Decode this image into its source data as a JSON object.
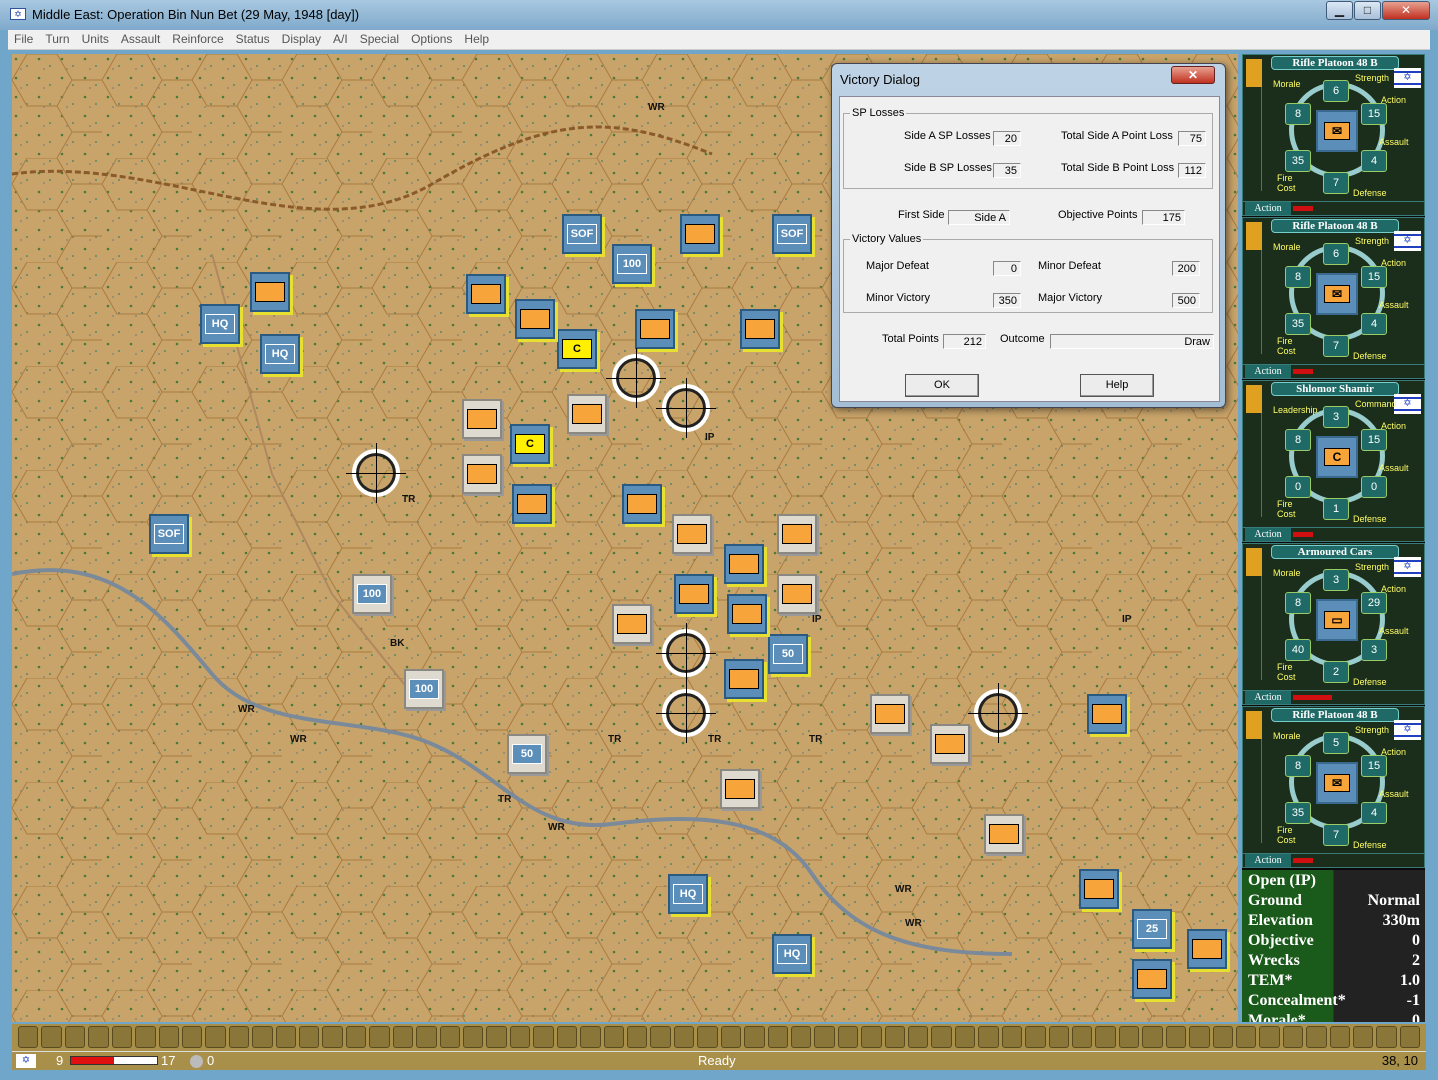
{
  "window": {
    "title": "Middle East: Operation Bin Nun Bet (29 May, 1948 [day])",
    "minimize": "▁",
    "maximize": "□",
    "close": "✕"
  },
  "menu": [
    "File",
    "Turn",
    "Units",
    "Assault",
    "Reinforce",
    "Status",
    "Display",
    "A/I",
    "Special",
    "Options",
    "Help"
  ],
  "map": {
    "counters": [
      "SOF",
      "SOF",
      "SOF",
      "HQ",
      "HQ",
      "HQ",
      "HQ",
      "C",
      "C",
      "100",
      "100",
      "100",
      "50",
      "50",
      "25"
    ],
    "labels": [
      "WR",
      "WR",
      "WR",
      "WR",
      "WR",
      "WR",
      "TR",
      "TR",
      "TR",
      "TR",
      "TR",
      "IP",
      "IP",
      "IP",
      "BK"
    ]
  },
  "dialog": {
    "title": "Victory Dialog",
    "close": "✕",
    "sp_losses": {
      "legend": "SP Losses",
      "side_a_label": "Side A SP Losses",
      "side_a": "20",
      "side_b_label": "Side B SP Losses",
      "side_b": "35",
      "total_a_label": "Total Side A Point Loss",
      "total_a": "75",
      "total_b_label": "Total Side B Point Loss",
      "total_b": "112"
    },
    "first_side_label": "First Side",
    "first_side": "Side A",
    "objective_label": "Objective Points",
    "objective": "175",
    "victory_values": {
      "legend": "Victory Values",
      "major_defeat_label": "Major Defeat",
      "major_defeat": "0",
      "minor_defeat_label": "Minor Defeat",
      "minor_defeat": "200",
      "minor_victory_label": "Minor Victory",
      "minor_victory": "350",
      "major_victory_label": "Major Victory",
      "major_victory": "500"
    },
    "total_label": "Total Points",
    "total": "212",
    "outcome_label": "Outcome",
    "outcome": "Draw",
    "ok": "OK",
    "help": "Help"
  },
  "units": [
    {
      "name": "Rifle Platoon 48 B",
      "tl": "Morale",
      "tr": "Strength",
      "r1": "Action",
      "r2": "Assault",
      "bl": "Fire Cost",
      "br": "Defense",
      "top": "6",
      "left": "8",
      "right": "15",
      "bleft": "35",
      "bright": "4",
      "bottom": "7",
      "action": "Action",
      "action_level": 0.15,
      "sym": "✉"
    },
    {
      "name": "Rifle Platoon 48 B",
      "tl": "Morale",
      "tr": "Strength",
      "r1": "Action",
      "r2": "Assault",
      "bl": "Fire Cost",
      "br": "Defense",
      "top": "6",
      "left": "8",
      "right": "15",
      "bleft": "35",
      "bright": "4",
      "bottom": "7",
      "action": "Action",
      "action_level": 0.15,
      "sym": "✉"
    },
    {
      "name": "Shlomor Shamir",
      "tl": "Leadership",
      "tr": "Command",
      "r1": "Action",
      "r2": "Assault",
      "bl": "Fire Cost",
      "br": "Defense",
      "top": "3",
      "left": "8",
      "right": "15",
      "bleft": "0",
      "bright": "0",
      "bottom": "1",
      "action": "Action",
      "action_level": 0.15,
      "sym": "C"
    },
    {
      "name": "Armoured Cars",
      "tl": "Morale",
      "tr": "Strength",
      "r1": "Action",
      "r2": "Assault",
      "bl": "Fire Cost",
      "br": "Defense",
      "top": "3",
      "left": "8",
      "right": "29",
      "bleft": "40",
      "bright": "3",
      "bottom": "2",
      "action": "Action",
      "action_level": 0.3,
      "sym": "▭"
    },
    {
      "name": "Rifle Platoon 48 B",
      "tl": "Morale",
      "tr": "Strength",
      "r1": "Action",
      "r2": "Assault",
      "bl": "Fire Cost",
      "br": "Defense",
      "top": "5",
      "left": "8",
      "right": "15",
      "bleft": "35",
      "bright": "4",
      "bottom": "7",
      "action": "Action",
      "action_level": 0.15,
      "sym": "✉"
    }
  ],
  "terrain": {
    "title": "Open (IP)",
    "rows": [
      [
        "Ground",
        "Normal"
      ],
      [
        "Elevation",
        "330m"
      ],
      [
        "Objective",
        "0"
      ],
      [
        "Wrecks",
        "2"
      ],
      [
        "TEM*",
        "1.0"
      ],
      [
        "Concealment*",
        "-1"
      ],
      [
        "Morale*",
        "0"
      ]
    ]
  },
  "status": {
    "side_flag": "✡",
    "value_a": "9",
    "value_b": "17",
    "progress": 0.5,
    "other": "0",
    "message": "Ready",
    "coords": "38, 10"
  }
}
